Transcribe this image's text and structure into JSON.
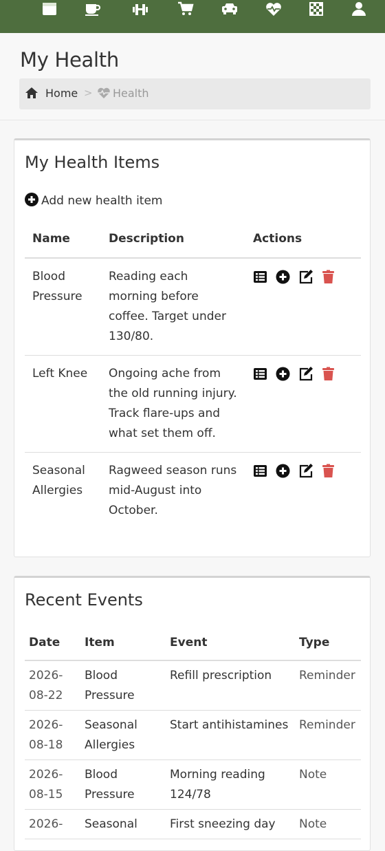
{
  "nav": {
    "icons": [
      "calendar-icon",
      "coffee-icon",
      "dumbbell-icon",
      "cart-icon",
      "car-icon",
      "heartbeat-icon",
      "chess-board-icon",
      "user-icon"
    ],
    "background": "#4e6e3e"
  },
  "header": {
    "title": "My Health",
    "breadcrumb": {
      "home": "Home",
      "separator": ">",
      "current": "Health"
    }
  },
  "health_items": {
    "title": "My Health Items",
    "add_label": "Add new health item",
    "columns": {
      "name": "Name",
      "description": "Description",
      "actions": "Actions"
    },
    "rows": [
      {
        "name": "Blood Pressure",
        "description": "Reading each morning before coffee. Target under 130/80."
      },
      {
        "name": "Left Knee",
        "description": "Ongoing ache from the old running injury. Track flare-ups and what set them off."
      },
      {
        "name": "Seasonal Allergies",
        "description": "Ragweed season runs mid-August into October."
      }
    ],
    "action_icons": [
      "list-icon",
      "plus-circle-icon",
      "edit-icon",
      "trash-icon"
    ],
    "delete_color": "#d9534f"
  },
  "recent_events": {
    "title": "Recent Events",
    "columns": {
      "date": "Date",
      "item": "Item",
      "event": "Event",
      "type": "Type"
    },
    "rows": [
      {
        "date": "2026-08-22",
        "item": "Blood Pressure",
        "event": "Refill prescription",
        "type": "Reminder"
      },
      {
        "date": "2026-08-18",
        "item": "Seasonal Allergies",
        "event": "Start antihistamines",
        "type": "Reminder"
      },
      {
        "date": "2026-08-15",
        "item": "Blood Pressure",
        "event": "Morning reading 124/78",
        "type": "Note"
      },
      {
        "date": "2026-",
        "item": "Seasonal",
        "event": "First sneezing day",
        "type": "Note"
      }
    ]
  }
}
